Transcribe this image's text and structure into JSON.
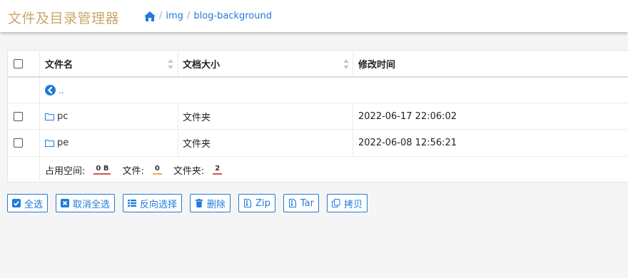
{
  "header": {
    "title": "文件及目录管理器",
    "breadcrumb": [
      "img",
      "blog-background"
    ]
  },
  "table": {
    "columns": [
      "文件名",
      "文档大小",
      "修改时间"
    ],
    "parent_link": "..",
    "rows": [
      {
        "name": "pc",
        "size": "文件夹",
        "modified": "2022-06-17 22:06:02"
      },
      {
        "name": "pe",
        "size": "文件夹",
        "modified": "2022-06-08 12:56:21"
      }
    ],
    "footer": {
      "space_label": "占用空间:",
      "space_value": "0 B",
      "files_label": "文件:",
      "files_value": "0",
      "folders_label": "文件夹:",
      "folders_value": "2"
    }
  },
  "actions": {
    "select_all": "全选",
    "deselect_all": "取消全选",
    "invert": "反向选择",
    "delete": "删除",
    "zip": "Zip",
    "tar": "Tar",
    "copy": "拷贝"
  },
  "colors": {
    "brand": "#c9a86a",
    "link": "#1e7bd8",
    "badge_red": "#d9534f",
    "badge_orange": "#f0ad4e"
  }
}
